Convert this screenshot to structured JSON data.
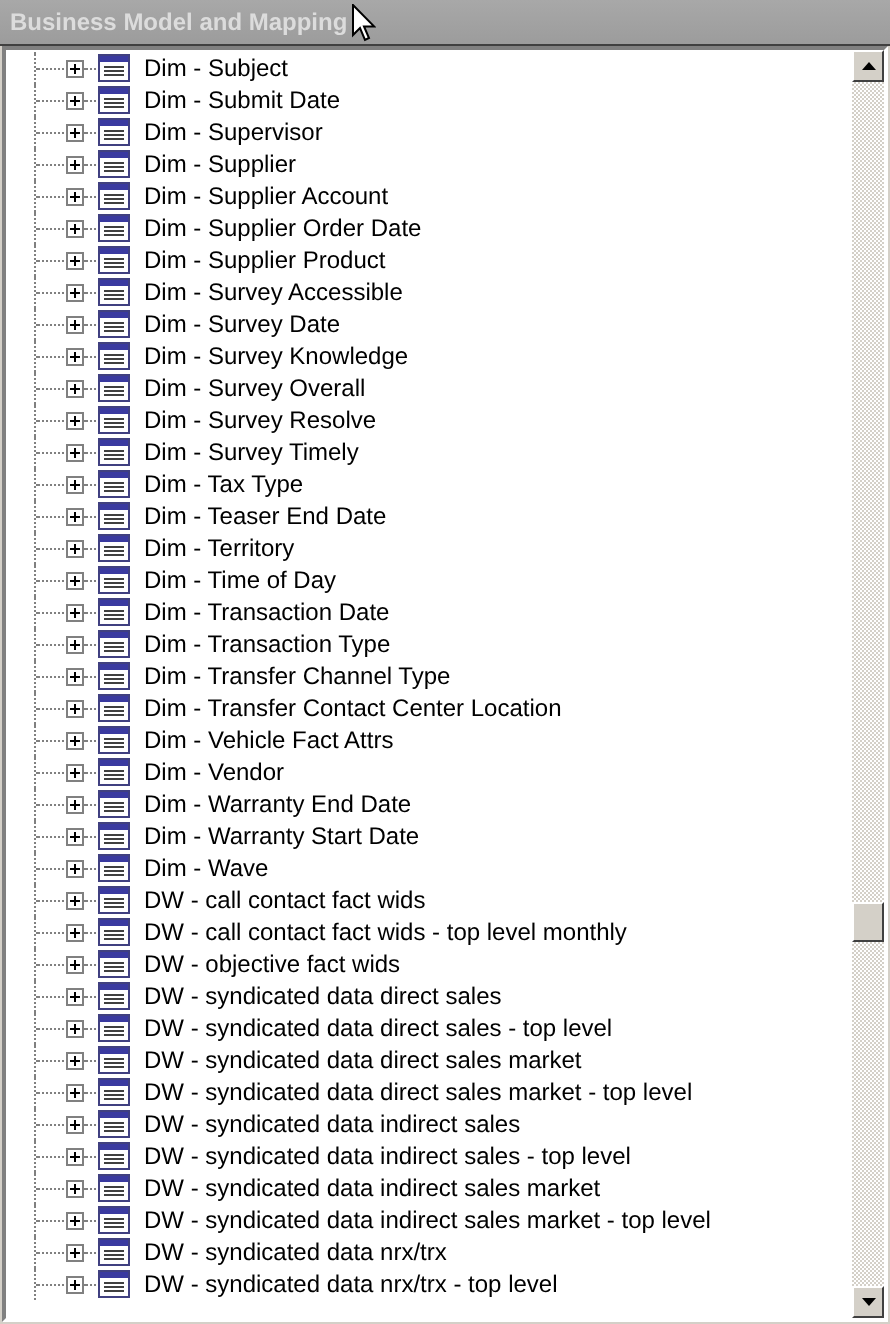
{
  "panel": {
    "title": "Business Model and Mapping"
  },
  "tree": {
    "items": [
      {
        "label": "Dim - Subject",
        "expanded": false
      },
      {
        "label": "Dim - Submit Date",
        "expanded": false
      },
      {
        "label": "Dim - Supervisor",
        "expanded": false
      },
      {
        "label": "Dim - Supplier",
        "expanded": false
      },
      {
        "label": "Dim - Supplier Account",
        "expanded": false
      },
      {
        "label": "Dim - Supplier Order Date",
        "expanded": false
      },
      {
        "label": "Dim - Supplier Product",
        "expanded": false
      },
      {
        "label": "Dim - Survey Accessible",
        "expanded": false
      },
      {
        "label": "Dim - Survey Date",
        "expanded": false
      },
      {
        "label": "Dim - Survey Knowledge",
        "expanded": false
      },
      {
        "label": "Dim - Survey Overall",
        "expanded": false
      },
      {
        "label": "Dim - Survey Resolve",
        "expanded": false
      },
      {
        "label": "Dim - Survey Timely",
        "expanded": false
      },
      {
        "label": "Dim - Tax Type",
        "expanded": false
      },
      {
        "label": "Dim - Teaser End Date",
        "expanded": false
      },
      {
        "label": "Dim - Territory",
        "expanded": false
      },
      {
        "label": "Dim - Time of Day",
        "expanded": false
      },
      {
        "label": "Dim - Transaction Date",
        "expanded": false
      },
      {
        "label": "Dim - Transaction Type",
        "expanded": false
      },
      {
        "label": "Dim - Transfer Channel Type",
        "expanded": false
      },
      {
        "label": "Dim - Transfer Contact Center Location",
        "expanded": false
      },
      {
        "label": "Dim - Vehicle Fact Attrs",
        "expanded": false
      },
      {
        "label": "Dim - Vendor",
        "expanded": false
      },
      {
        "label": "Dim - Warranty End Date",
        "expanded": false
      },
      {
        "label": "Dim - Warranty Start Date",
        "expanded": false
      },
      {
        "label": "Dim - Wave",
        "expanded": false
      },
      {
        "label": "DW - call contact fact wids",
        "expanded": false
      },
      {
        "label": "DW - call contact fact wids - top level monthly",
        "expanded": false
      },
      {
        "label": "DW - objective fact wids",
        "expanded": false
      },
      {
        "label": "DW - syndicated data direct sales",
        "expanded": false
      },
      {
        "label": "DW - syndicated data direct sales - top level",
        "expanded": false
      },
      {
        "label": "DW - syndicated data direct sales market",
        "expanded": false
      },
      {
        "label": "DW - syndicated data direct sales market - top level",
        "expanded": false
      },
      {
        "label": "DW - syndicated data indirect sales",
        "expanded": false
      },
      {
        "label": "DW - syndicated data indirect sales - top level",
        "expanded": false
      },
      {
        "label": "DW - syndicated data indirect sales market",
        "expanded": false
      },
      {
        "label": "DW - syndicated data indirect sales market - top level",
        "expanded": false
      },
      {
        "label": "DW - syndicated data nrx/trx",
        "expanded": false
      },
      {
        "label": "DW - syndicated data nrx/trx - top level",
        "expanded": false
      }
    ]
  }
}
